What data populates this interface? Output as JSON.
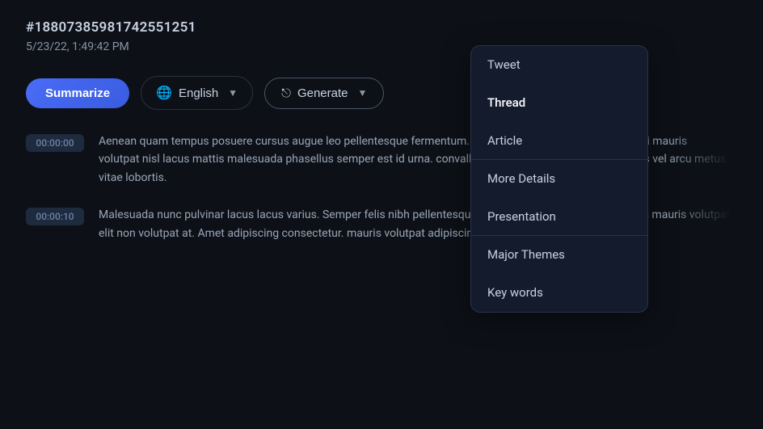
{
  "header": {
    "id": "#18807385981742551251",
    "date": "5/23/22, 1:49:42 PM"
  },
  "toolbar": {
    "summarize_label": "Summarize",
    "language_label": "English",
    "generate_label": "Generate"
  },
  "dropdown": {
    "items": [
      {
        "label": "Tweet",
        "active": false,
        "separator": false
      },
      {
        "label": "Thread",
        "active": true,
        "separator": false
      },
      {
        "label": "Article",
        "active": false,
        "separator": true
      },
      {
        "label": "More Details",
        "active": false,
        "separator": false
      },
      {
        "label": "Presentation",
        "active": false,
        "separator": true
      },
      {
        "label": "Major Themes",
        "active": false,
        "separator": false
      },
      {
        "label": "Key words",
        "active": false,
        "separator": false
      }
    ]
  },
  "transcript": {
    "items": [
      {
        "timestamp": "00:00:00",
        "text": "Aenean quam tempus posuere cursus augue leo pellentesque fermentum. Nunc adipiscing etiam. At at facilisi mauris volutpat nisl lacus mattis malesuada phasellus semper est id urna. convallis ac mattis quisque. Molestie gittis vel arcu metus vitae lobortis."
      },
      {
        "timestamp": "00:00:10",
        "text": "Malesuada nunc pulvinar lacus lacus varius. Semper felis nibh pellentesque convallis et. Suspendisse ultricies mauris volutpat elit non volutpat at. Amet adipiscing consectetur. mauris volutpat adipiscing dui. u amet lorem nunc."
      }
    ]
  }
}
